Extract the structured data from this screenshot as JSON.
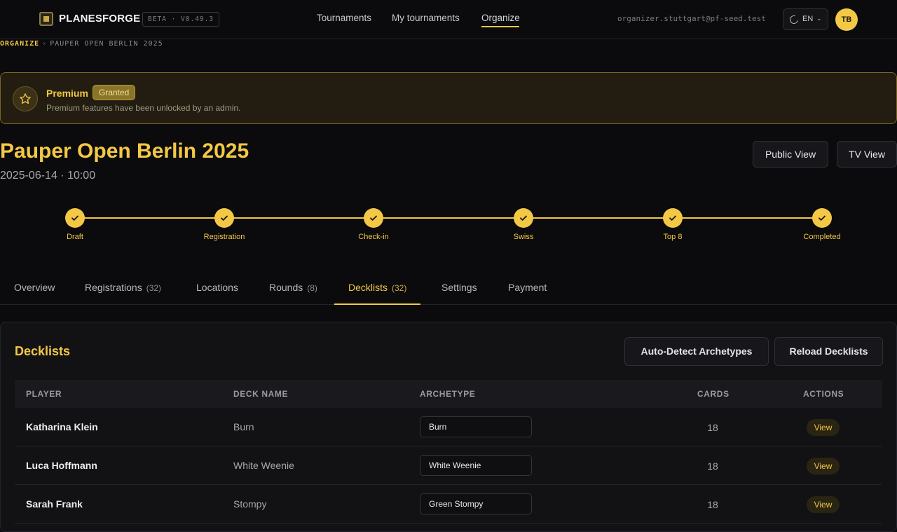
{
  "header": {
    "brand": "PLANESFORGE",
    "version": "BETA · V0.49.3",
    "nav": [
      "Tournaments",
      "My tournaments",
      "Organize"
    ],
    "email": "organizer.stuttgart@pf-seed.test",
    "lang": "EN",
    "avatar": "TB"
  },
  "breadcrumb": {
    "root": "ORGANIZE",
    "separator": "›",
    "current": "PAUPER OPEN BERLIN 2025"
  },
  "premium": {
    "title": "Premium",
    "badge": "Granted",
    "description": "Premium features have been unlocked by an admin."
  },
  "event": {
    "title": "Pauper Open Berlin 2025",
    "datetime": "2025-06-14 · 10:00",
    "public_view": "Public View",
    "tv_view": "TV View"
  },
  "stages": [
    "Draft",
    "Registration",
    "Check-in",
    "Swiss",
    "Top 8",
    "Completed"
  ],
  "tabs": [
    {
      "label": "Overview",
      "count": ""
    },
    {
      "label": "Registrations",
      "count": "(32)"
    },
    {
      "label": "Locations",
      "count": ""
    },
    {
      "label": "Rounds",
      "count": "(8)"
    },
    {
      "label": "Decklists",
      "count": "(32)"
    },
    {
      "label": "Settings",
      "count": ""
    },
    {
      "label": "Payment",
      "count": ""
    }
  ],
  "decklists": {
    "title": "Decklists",
    "auto_detect": "Auto-Detect Archetypes",
    "reload": "Reload Decklists",
    "columns": [
      "PLAYER",
      "DECK NAME",
      "ARCHETYPE",
      "CARDS",
      "ACTIONS"
    ],
    "rows": [
      {
        "player": "Katharina Klein",
        "deck": "Burn",
        "archetype": "Burn",
        "cards": "18",
        "action": "View"
      },
      {
        "player": "Luca Hoffmann",
        "deck": "White Weenie",
        "archetype": "White Weenie",
        "cards": "18",
        "action": "View"
      },
      {
        "player": "Sarah Frank",
        "deck": "Stompy",
        "archetype": "Green Stompy",
        "cards": "18",
        "action": "View"
      }
    ]
  },
  "colors": {
    "accent": "#f3c845",
    "background": "#0b0b0d",
    "panel": "#121215"
  }
}
